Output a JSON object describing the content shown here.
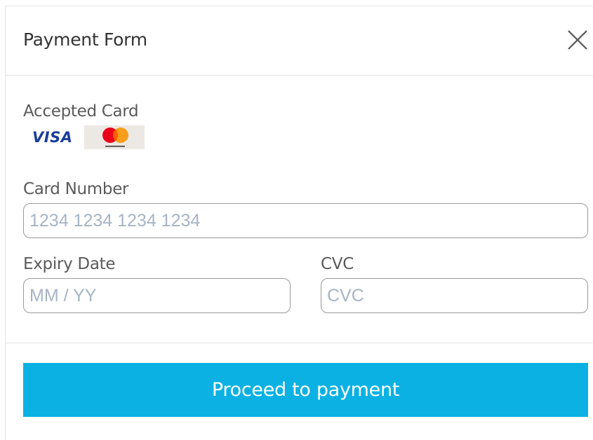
{
  "modal": {
    "title": "Payment Form"
  },
  "accepted": {
    "label": "Accepted Card",
    "cards": [
      {
        "name": "VISA",
        "icon": "visa-logo-icon",
        "color": "#1a3d9a"
      },
      {
        "name": "Mastercard",
        "icon": "mastercard-logo-icon",
        "colors": [
          "#eb001b",
          "#f79e1b"
        ]
      }
    ]
  },
  "card_number": {
    "label": "Card Number",
    "placeholder": "1234 1234 1234 1234",
    "value": ""
  },
  "expiry": {
    "label": "Expiry Date",
    "placeholder": "MM / YY",
    "value": ""
  },
  "cvc": {
    "label": "CVC",
    "placeholder": "CVC",
    "value": ""
  },
  "submit": {
    "label": "Proceed to payment",
    "color": "#0bb1e3"
  },
  "icons": {
    "close": "close-icon"
  }
}
